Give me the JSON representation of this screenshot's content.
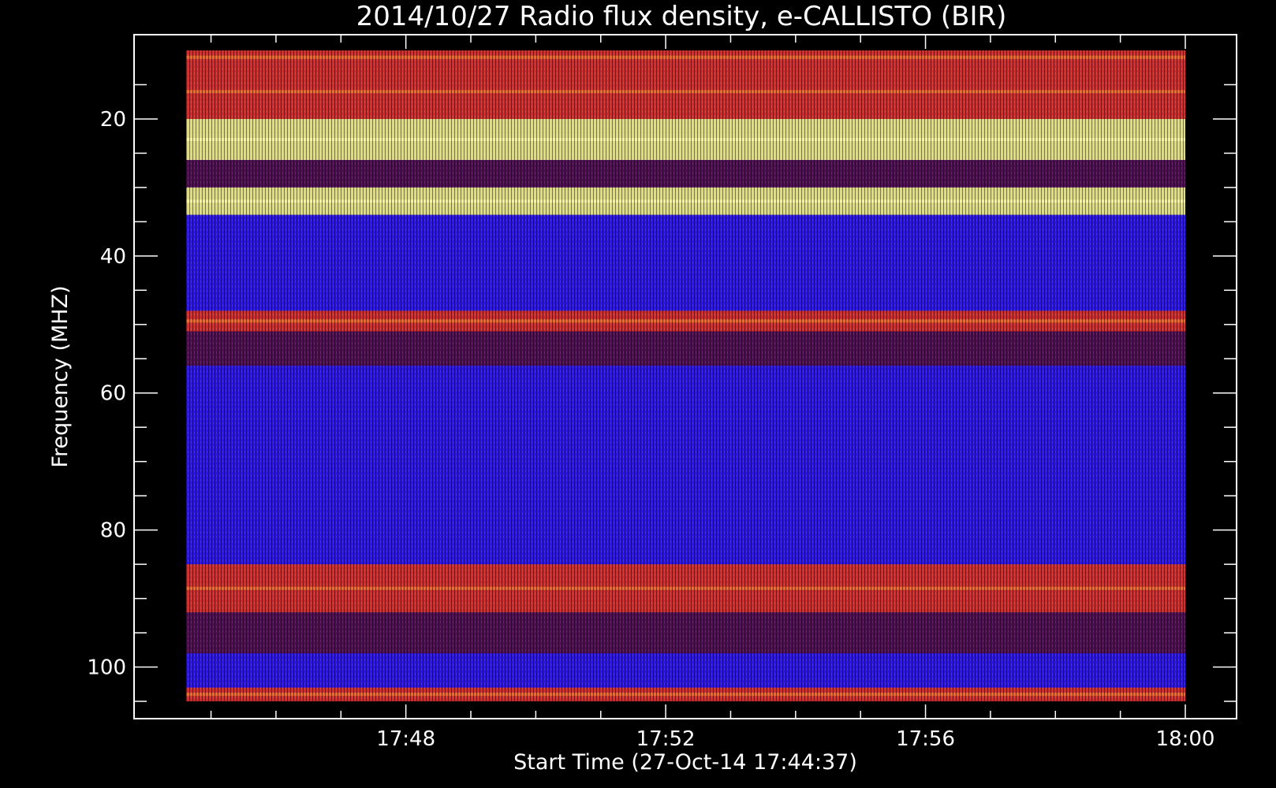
{
  "chart_data": {
    "type": "heatmap",
    "title": "2014/10/27  Radio flux density, e-CALLISTO (BIR)",
    "xlabel": "Start Time (27-Oct-14 17:44:37)",
    "ylabel": "Frequency (MHZ)",
    "x_axis": {
      "unit": "time",
      "range": [
        "17:44:37",
        "18:00:00"
      ],
      "ticks": [
        "17:48",
        "17:52",
        "17:56",
        "18:00"
      ]
    },
    "y_axis": {
      "unit": "MHz",
      "range": [
        10,
        105
      ],
      "ticks": [
        20,
        40,
        60,
        80,
        100
      ],
      "inverted": true
    },
    "intensity_bands_mhz": [
      {
        "from": 10,
        "to": 12,
        "level": "high"
      },
      {
        "from": 12,
        "to": 20,
        "level": "high"
      },
      {
        "from": 20,
        "to": 26,
        "level": "very-high"
      },
      {
        "from": 26,
        "to": 30,
        "level": "medium"
      },
      {
        "from": 30,
        "to": 34,
        "level": "very-high"
      },
      {
        "from": 34,
        "to": 48,
        "level": "low"
      },
      {
        "from": 48,
        "to": 51,
        "level": "high"
      },
      {
        "from": 51,
        "to": 56,
        "level": "medium"
      },
      {
        "from": 56,
        "to": 85,
        "level": "low"
      },
      {
        "from": 85,
        "to": 92,
        "level": "high"
      },
      {
        "from": 92,
        "to": 98,
        "level": "medium"
      },
      {
        "from": 98,
        "to": 103,
        "level": "low"
      },
      {
        "from": 103,
        "to": 105,
        "level": "high"
      }
    ],
    "colors": {
      "background": "#000000",
      "low": "#2a12ff",
      "medium": "#5a0a3a",
      "high": "#ff2a00",
      "very-high": "#ffff60",
      "axis": "#ffffff"
    }
  }
}
